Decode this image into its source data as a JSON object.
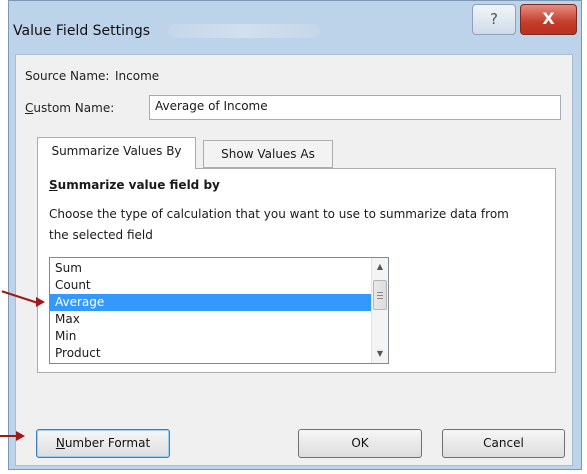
{
  "window": {
    "title": "Value Field Settings",
    "help_label": "?",
    "close_label": "X"
  },
  "form": {
    "source_name_label": "Source Name:",
    "source_name_value": "Income",
    "custom_name_label_prefix": "C",
    "custom_name_label_rest": "ustom Name:",
    "custom_name_value": "Average of Income"
  },
  "tabs": [
    {
      "label": "Summarize Values By",
      "active": true
    },
    {
      "label": "Show Values As",
      "active": false
    }
  ],
  "panel": {
    "heading_prefix": "S",
    "heading_rest": "ummarize value field by",
    "description": "Choose the type of calculation that you want to use to summarize data from the selected field"
  },
  "listbox": {
    "items": [
      "Sum",
      "Count",
      "Average",
      "Max",
      "Min",
      "Product"
    ],
    "selected": "Average"
  },
  "buttons": {
    "number_format_prefix": "N",
    "number_format_rest": "umber Format",
    "ok": "OK",
    "cancel": "Cancel"
  },
  "colors": {
    "selection": "#3399ff",
    "arrow": "#a01818",
    "close_button": "#c43c2a"
  }
}
